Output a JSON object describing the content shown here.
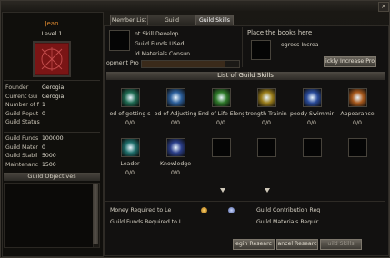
{
  "window": {
    "close_label": "×"
  },
  "character": {
    "name": "Jean",
    "level_label": "Level 1",
    "info": [
      {
        "k": "Founder",
        "v": "Gerogia"
      },
      {
        "k": "Current Gui",
        "v": "Gerogia"
      },
      {
        "k": "Number of f",
        "v": "1"
      },
      {
        "k": "Guild Reput",
        "v": "0"
      },
      {
        "k": "Guild Status",
        "v": ""
      }
    ],
    "stats": [
      {
        "k": "Guild Funds",
        "v": "100000"
      },
      {
        "k": "Guild Mater",
        "v": "0"
      },
      {
        "k": "Guild Stabil",
        "v": "5000"
      },
      {
        "k": "Maintenanc",
        "v": "1500"
      }
    ],
    "objectives_label": "Guild Objectives"
  },
  "tabs": [
    "Member List",
    "Guild Information",
    "Guild Skills"
  ],
  "develop": {
    "lines": [
      "nt Skill Develop",
      "Guild Funds USed",
      "ld Materials Consun"
    ],
    "progress_label": "opment Pro",
    "progress": 0.85
  },
  "books": {
    "title": "Place the books here",
    "progress_text": "ogress Increa",
    "button": "ickly Increase Pro"
  },
  "skills": {
    "header": "List of Guild Skills",
    "row1": [
      {
        "name": "od of getting s",
        "count": "0/0",
        "icon": "green-swirl-icon",
        "color": "#1f6b52"
      },
      {
        "name": "od of Adjusting",
        "count": "0/0",
        "icon": "blue-glove-icon",
        "color": "#2c5f9b"
      },
      {
        "name": "End of Life Elong",
        "count": "0/0",
        "icon": "green-heal-icon",
        "color": "#2f7a2a"
      },
      {
        "name": "trength Trainin",
        "count": "0/0",
        "icon": "yellow-power-icon",
        "color": "#9a7d1b"
      },
      {
        "name": "peedy Swimmir",
        "count": "0/0",
        "icon": "blue-wave-icon",
        "color": "#2a4b9a"
      },
      {
        "name": "Appearance",
        "count": "0/0",
        "icon": "orange-figure-icon",
        "color": "#a8591c"
      }
    ],
    "row2": [
      {
        "name": "Leader",
        "count": "0/0",
        "icon": "teal-leader-icon",
        "color": "#1e6e6a"
      },
      {
        "name": "Knowledge",
        "count": "0/0",
        "icon": "blue-star-icon",
        "color": "#2b3f8a"
      }
    ]
  },
  "requirements": {
    "money": "Money Required to Le",
    "funds": "Guild Funds Required to L",
    "contribution": "Guild Contribution Req",
    "materials": "Guild Materials Requir"
  },
  "buttons": {
    "begin": "egin Researc",
    "cancel": "ancel Researc",
    "skills": "uild Skills"
  }
}
